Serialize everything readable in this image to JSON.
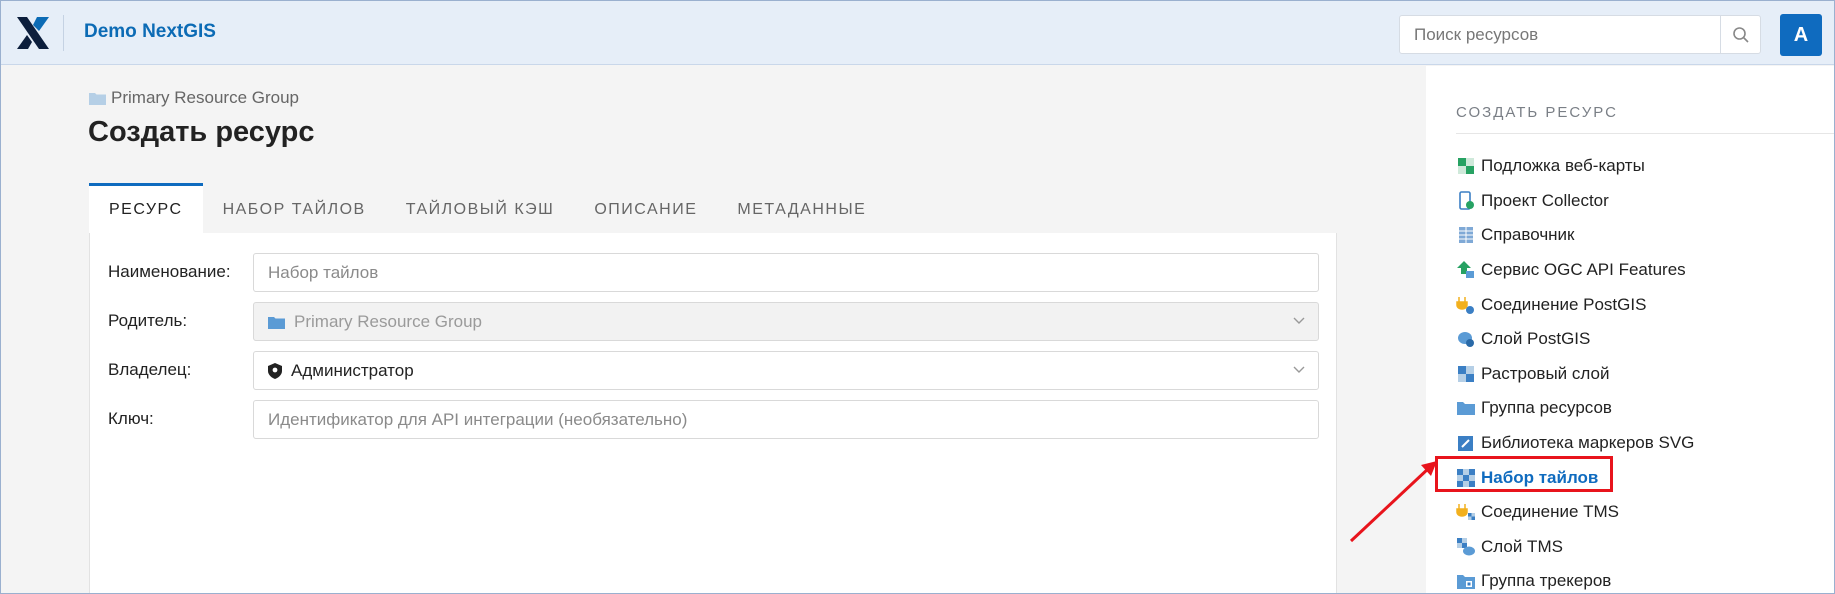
{
  "header": {
    "app_title": "Demo NextGIS",
    "search_placeholder": "Поиск ресурсов",
    "avatar_letter": "A",
    "brand_color": "#0f6bbf"
  },
  "breadcrumb": {
    "label": "Primary Resource Group"
  },
  "page_title": "Создать ресурс",
  "tabs": [
    {
      "label": "РЕСУРС",
      "active": true
    },
    {
      "label": "НАБОР ТАЙЛОВ"
    },
    {
      "label": "ТАЙЛОВЫЙ КЭШ"
    },
    {
      "label": "ОПИСАНИЕ"
    },
    {
      "label": "МЕТАДАННЫЕ"
    }
  ],
  "form": {
    "name_label": "Наименование:",
    "name_placeholder": "Набор тайлов",
    "parent_label": "Родитель:",
    "parent_value": "Primary Resource Group",
    "owner_label": "Владелец:",
    "owner_value": "Администратор",
    "key_label": "Ключ:",
    "key_placeholder": "Идентификатор для API интеграции (необязательно)"
  },
  "sidebar": {
    "title": "СОЗДАТЬ РЕСУРС",
    "items": [
      {
        "label": "Подложка веб-карты",
        "icon": "basemap-icon"
      },
      {
        "label": "Проект Collector",
        "icon": "collector-icon"
      },
      {
        "label": "Справочник",
        "icon": "lookup-table-icon"
      },
      {
        "label": "Сервис OGC API Features",
        "icon": "ogcf-service-icon"
      },
      {
        "label": "Соединение PostGIS",
        "icon": "postgis-connection-icon"
      },
      {
        "label": "Слой PostGIS",
        "icon": "postgis-layer-icon"
      },
      {
        "label": "Растровый слой",
        "icon": "raster-layer-icon"
      },
      {
        "label": "Группа ресурсов",
        "icon": "folder-icon"
      },
      {
        "label": "Библиотека маркеров SVG",
        "icon": "svg-marker-library-icon"
      },
      {
        "label": "Набор тайлов",
        "icon": "tileset-icon",
        "highlighted": true
      },
      {
        "label": "Соединение TMS",
        "icon": "tms-connection-icon"
      },
      {
        "label": "Слой TMS",
        "icon": "tms-layer-icon"
      },
      {
        "label": "Группа трекеров",
        "icon": "tracker-group-icon"
      }
    ]
  },
  "annotation_color": "#e8141c"
}
